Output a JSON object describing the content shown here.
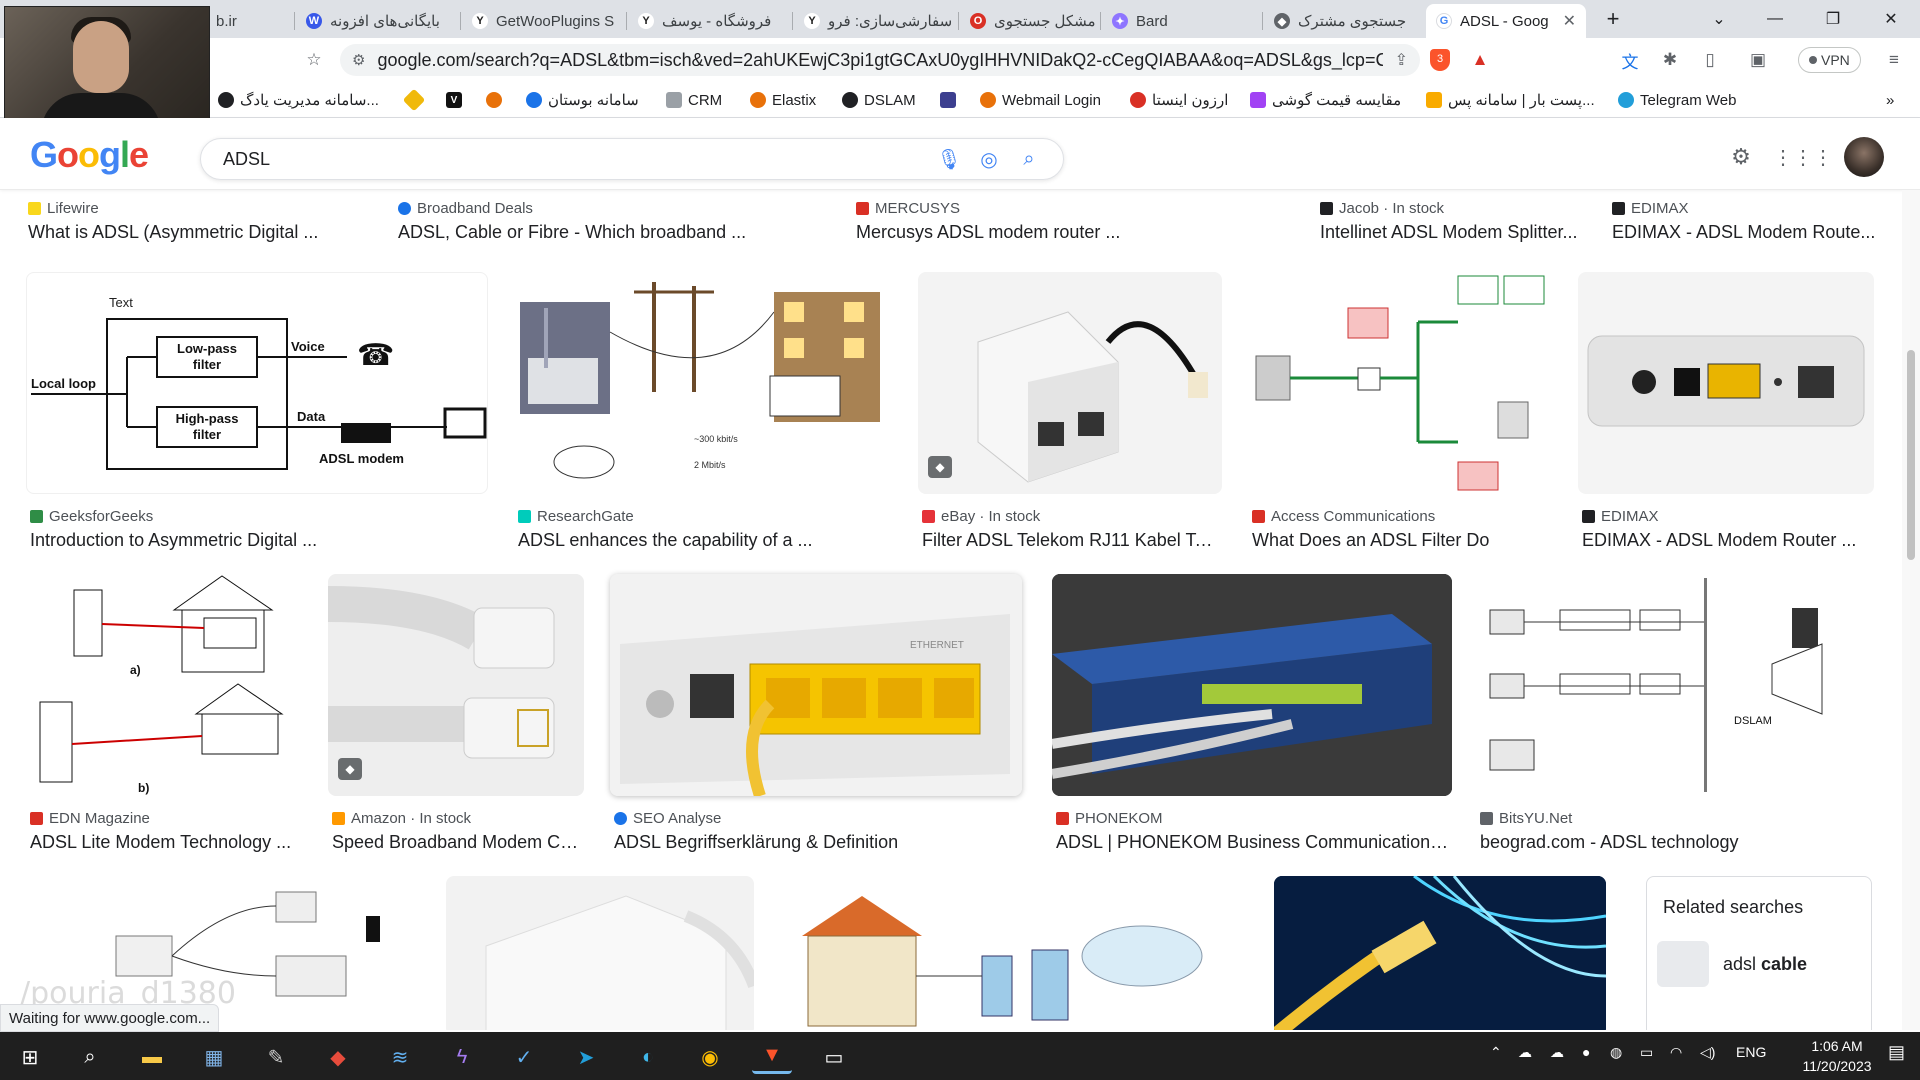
{
  "tabs": [
    {
      "label": "b.ir",
      "icon": "site-icon"
    },
    {
      "label": "بایگانی‌های افزونه",
      "icon": "wordpress-icon"
    },
    {
      "label": "GetWooPlugins S",
      "icon": "woo-icon"
    },
    {
      "label": "فروشگاه - یوسف",
      "icon": "woo-icon"
    },
    {
      "label": "سفارشی‌سازی: فرو",
      "icon": "woo-icon"
    },
    {
      "label": "مشکل جستجوی",
      "icon": "opera-icon"
    },
    {
      "label": "Bard",
      "icon": "bard-icon"
    },
    {
      "label": "جستجوی مشترک",
      "icon": "site-icon"
    },
    {
      "label": "ADSL - Goog",
      "icon": "google-icon",
      "active": true
    }
  ],
  "address_bar": {
    "url": "google.com/search?q=ADSL&tbm=isch&ved=2ahUKEwjC3pi1gtGCAxU0ygIHHVNIDakQ2-cCegQIABAA&oq=ADSL&gs_lcp=C...",
    "vpn_label": "VPN",
    "shield_count": "3"
  },
  "bookmarks": [
    {
      "label": "سامانه مدیریت یادگ...",
      "color": "#202124"
    },
    {
      "label": "",
      "color": "#f0b90b"
    },
    {
      "label": "",
      "color": "#111111"
    },
    {
      "label": "",
      "color": "#e8710a"
    },
    {
      "label": "سامانه بوستان",
      "color": "#1a73e8"
    },
    {
      "label": "CRM",
      "color": "#5f6368"
    },
    {
      "label": "Elastix",
      "color": "#e8710a"
    },
    {
      "label": "DSLAM",
      "color": "#202124"
    },
    {
      "label": "",
      "color": "#3c3f8f"
    },
    {
      "label": "Webmail Login",
      "color": "#e8710a"
    },
    {
      "label": "ارزون اینستا",
      "color": "#d93025"
    },
    {
      "label": "مقایسه قیمت گوشی",
      "color": "#a142f4"
    },
    {
      "label": "پست بار | سامانه پس...",
      "color": "#f9ab00"
    },
    {
      "label": "Telegram Web",
      "color": "#229ed9"
    }
  ],
  "search": {
    "logo": "Google",
    "query": "ADSL"
  },
  "results": [
    {
      "source": "Lifewire",
      "title": "What is ADSL (Asymmetric Digital ...",
      "src_color": "#f9d71c"
    },
    {
      "source": "Broadband Deals",
      "title": "ADSL, Cable or Fibre - Which broadband ...",
      "src_color": "#1a73e8"
    },
    {
      "source": "MERCUSYS",
      "title": "Mercusys ADSL modem router ...",
      "src_color": "#d93025"
    },
    {
      "source": "Jacob · In stock",
      "title": "Intellinet ADSL Modem Splitter...",
      "src_color": "#202124"
    },
    {
      "source": "EDIMAX",
      "title": "EDIMAX - ADSL Modem Route...",
      "src_color": "#202124"
    },
    {
      "source": "GeeksforGeeks",
      "title": "Introduction to Asymmetric Digital ...",
      "src_color": "#2f8d46"
    },
    {
      "source": "ResearchGate",
      "title": "ADSL enhances the capability of a ...",
      "src_color": "#00ccbb"
    },
    {
      "source": "eBay · In stock",
      "title": "Filter ADSL Telekom RJ11 Kabel Tel...",
      "src_color": "#e53238"
    },
    {
      "source": "Access Communications",
      "title": "What Does an ADSL Filter Do",
      "src_color": "#d93025"
    },
    {
      "source": "EDIMAX",
      "title": "EDIMAX - ADSL Modem Router ...",
      "src_color": "#202124"
    },
    {
      "source": "EDN Magazine",
      "title": "ADSL Lite Modem Technology ...",
      "src_color": "#d93025"
    },
    {
      "source": "Amazon · In stock",
      "title": "Speed Broadband Modem Ca...",
      "src_color": "#ff9900"
    },
    {
      "source": "SEO Analyse",
      "title": "ADSL Begriffserklärung & Definition",
      "src_color": "#1a73e8"
    },
    {
      "source": "PHONEKOM",
      "title": "ADSL | PHONEKOM Business Communications...",
      "src_color": "#d93025"
    },
    {
      "source": "BitsYU.Net",
      "title": "beograd.com - ADSL technology",
      "src_color": "#5f6368"
    }
  ],
  "diagram_labels": {
    "lowpass": "Low-pass filter",
    "highpass": "High-pass filter",
    "voice": "Voice",
    "data": "Data",
    "local_loop": "Local loop",
    "text": "Text",
    "adsl_modem": "ADSL modem",
    "edn_a": "a)",
    "edn_b": "b)",
    "dslam": "DSLAM"
  },
  "related": {
    "heading": "Related searches",
    "items": [
      {
        "label_plain": "adsl ",
        "label_bold": "cable"
      }
    ]
  },
  "status_text": "Waiting for www.google.com...",
  "watermark": "/pouria_d1380",
  "taskbar": {
    "tray_lang": "ENG",
    "time": "1:06 AM",
    "date": "11/20/2023"
  }
}
